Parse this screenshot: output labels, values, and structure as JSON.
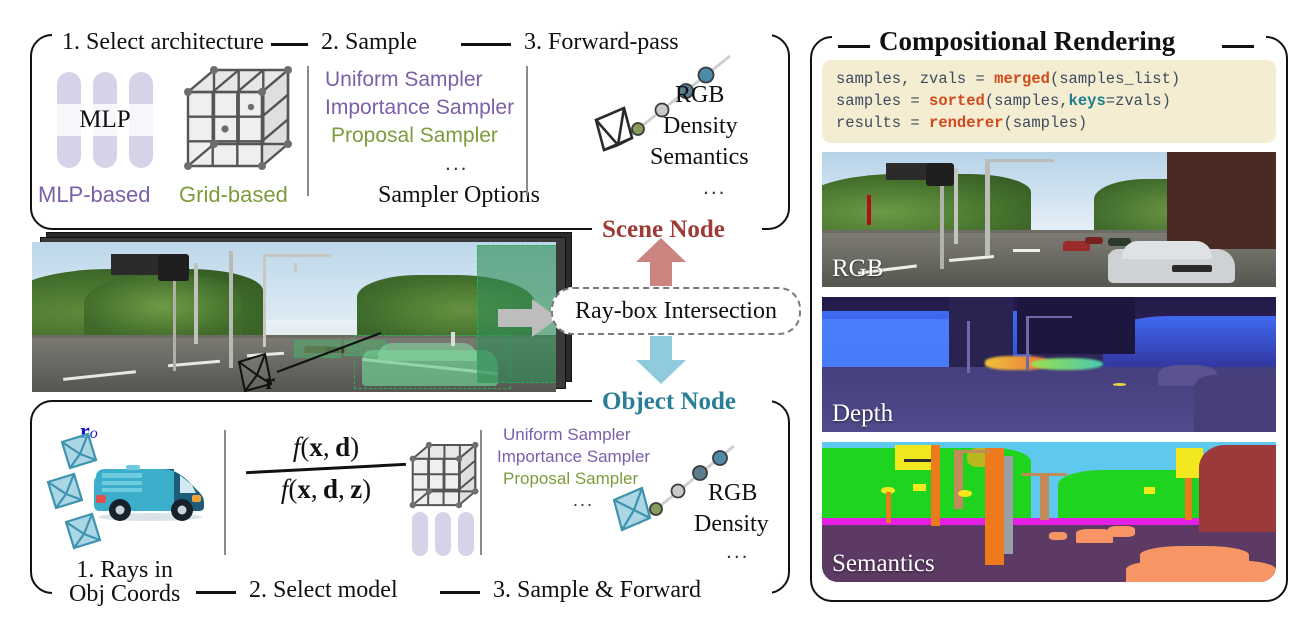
{
  "scene_panel": {
    "steps": [
      {
        "label": "1. Select architecture"
      },
      {
        "label": "2. Sample"
      },
      {
        "label": "3. Forward-pass"
      }
    ],
    "architecture": {
      "mlp_glyph_label": "MLP",
      "mlp_caption": "MLP-based",
      "grid_caption": "Grid-based"
    },
    "samplers": {
      "items": [
        {
          "label": "Uniform Sampler",
          "color": "#7B5FA8"
        },
        {
          "label": "Importance Sampler",
          "color": "#7B5FA8"
        },
        {
          "label": "Proposal Sampler",
          "color": "#7E9B3D"
        }
      ],
      "ellipsis": "...",
      "caption": "Sampler Options"
    },
    "outputs": {
      "items": [
        "RGB",
        "Density",
        "Semantics"
      ],
      "ellipsis": "..."
    },
    "node_label": "Scene Node"
  },
  "bridge": {
    "ray_box_label": "Ray-box Intersection",
    "up_arrow_color": "#CB8480",
    "down_arrow_color": "#8FCBDD"
  },
  "object_panel": {
    "node_label": "Object Node",
    "steps": [
      {
        "label": "1. Rays in\nObj Coords"
      },
      {
        "label": "2. Select model"
      },
      {
        "label": "3. Sample & Forward"
      }
    ],
    "ray_symbol": "r",
    "ray_symbol_sub": "o",
    "model": {
      "numerator": "f(x, d)",
      "denominator": "f(x, d, z)"
    },
    "samplers": {
      "items": [
        {
          "label": "Uniform Sampler",
          "color": "#7B5FA8"
        },
        {
          "label": "Importance Sampler",
          "color": "#7B5FA8"
        },
        {
          "label": "Proposal Sampler",
          "color": "#7E9B3D"
        }
      ],
      "ellipsis": "..."
    },
    "outputs": {
      "items": [
        "RGB",
        "Density"
      ],
      "ellipsis": "..."
    }
  },
  "scene_image": {
    "ray_label": "r"
  },
  "rendering_panel": {
    "title": "Compositional Rendering",
    "code": {
      "lines": [
        [
          {
            "t": "samples, zvals = ",
            "k": "plain"
          },
          {
            "t": "merged",
            "k": "fn"
          },
          {
            "t": "(samples_list)",
            "k": "plain"
          }
        ],
        [
          {
            "t": "samples = ",
            "k": "plain"
          },
          {
            "t": "sorted",
            "k": "fn"
          },
          {
            "t": "(samples,",
            "k": "plain"
          },
          {
            "t": "keys",
            "k": "kw"
          },
          {
            "t": "=zvals)",
            "k": "plain"
          }
        ],
        [
          {
            "t": "results = ",
            "k": "plain"
          },
          {
            "t": "renderer",
            "k": "fn"
          },
          {
            "t": "(samples)",
            "k": "plain"
          }
        ]
      ],
      "bg_color": "#F4EDD2",
      "fn_color": "#D2491B",
      "kw_color": "#1B7E8C",
      "text_color": "#3C4B5E"
    },
    "outputs": [
      {
        "tag": "RGB"
      },
      {
        "tag": "Depth"
      },
      {
        "tag": "Semantics"
      }
    ]
  }
}
